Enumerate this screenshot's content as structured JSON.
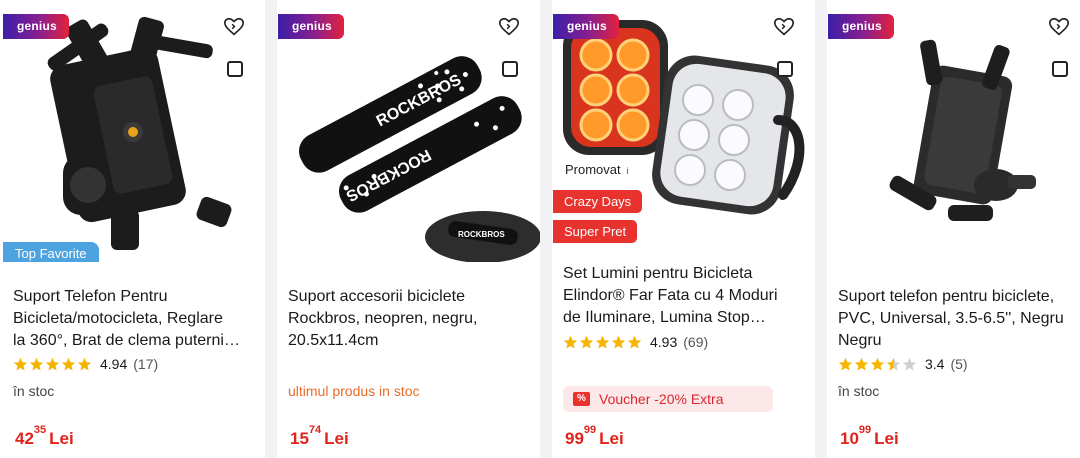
{
  "products": [
    {
      "badge_genius": "genius",
      "badge_top": "Top Favorite",
      "title_lines": [
        "Suport Telefon Pentru",
        "Bicicleta/motocicleta, Reglare",
        "la 360°, Brat de clema puterni…"
      ],
      "rating": "4.94",
      "reviews": "(17)",
      "stars_filled": 5,
      "stock": "în stoc",
      "price_int": "42",
      "price_dec": "35",
      "currency": "Lei",
      "icons": [
        "heart-plus-icon",
        "compare-checkbox-icon"
      ]
    },
    {
      "badge_genius": "genius",
      "image_text": [
        "ROCKBROS",
        "ROCKBROS",
        "ROCKBROS"
      ],
      "title_lines": [
        "Suport accesorii biciclete",
        "Rockbros, neopren, negru,",
        "20.5x11.4cm"
      ],
      "stock": "ultimul produs in stoc",
      "price_int": "15",
      "price_dec": "74",
      "currency": "Lei"
    },
    {
      "badge_genius": "genius",
      "promovat": "Promovat",
      "promovat_info": "i",
      "tag1": "Crazy Days",
      "tag2": "Super Pret",
      "title_lines": [
        "Set Lumini pentru Bicicleta",
        "Elindor® Far Fata cu 4 Moduri",
        "de Iluminare, Lumina Stop…"
      ],
      "rating": "4.93",
      "reviews": "(69)",
      "stars_filled": 5,
      "voucher_icon": "%",
      "voucher": "Voucher -20% Extra",
      "price_int": "99",
      "price_dec": "99",
      "currency": "Lei"
    },
    {
      "badge_genius": "genius",
      "title_lines": [
        "Suport telefon pentru biciclete,",
        "PVC, Universal, 3.5-6.5'', Negru",
        "Negru"
      ],
      "rating": "3.4",
      "reviews": "(5)",
      "stars_filled": 3.5,
      "stock": "în stoc",
      "price_int": "10",
      "price_dec": "99",
      "currency": "Lei"
    }
  ],
  "colors": {
    "price": "#e0231b",
    "star": "#f5b400",
    "star_empty": "#d0d0d0",
    "top_favorite": "#4da3e0",
    "tag_red": "#e8322d",
    "stock_last": "#e96c2a"
  }
}
